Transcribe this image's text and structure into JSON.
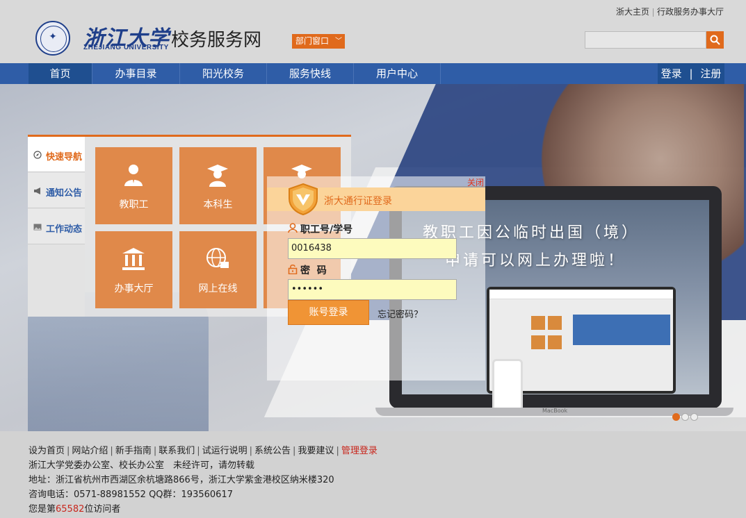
{
  "header": {
    "logo_cn": "浙江大学",
    "logo_en": "ZHEJIANG UNIVERSITY",
    "site_title": "校务服务网",
    "dept_button": "部门窗口",
    "top_links": [
      "浙大主页",
      "行政服务办事大厅"
    ],
    "search": {
      "value": "",
      "icon": "search-icon"
    }
  },
  "nav": {
    "items": [
      "首页",
      "办事目录",
      "阳光校务",
      "服务快线",
      "用户中心"
    ],
    "active": "首页",
    "login": "登录",
    "divider": "|",
    "register": "注册"
  },
  "banner": {
    "headline_1": "教职工因公临时出国（境）",
    "headline_2": "申请可以网上办理啦！",
    "laptop_brand": "MacBook",
    "slide_count": 3,
    "active_slide": 1
  },
  "quick_panel": {
    "tabs": [
      {
        "label": "快速导航",
        "icon": "compass-icon"
      },
      {
        "label": "通知公告",
        "icon": "megaphone-icon"
      },
      {
        "label": "工作动态",
        "icon": "image-icon"
      }
    ],
    "tiles": [
      {
        "label": "教职工",
        "icon": "staff-icon"
      },
      {
        "label": "本科生",
        "icon": "graduate-icon"
      },
      {
        "label": "",
        "icon": "graduate-icon"
      },
      {
        "label": "办事大厅",
        "icon": "building-icon"
      },
      {
        "label": "网上在线",
        "icon": "globe-icon"
      },
      {
        "label": "",
        "icon": "tile-icon"
      }
    ]
  },
  "login": {
    "close": "关闭",
    "title": "浙大通行证登录",
    "user_label": "职工号/学号",
    "user_value": "0016438",
    "password_label": "密  码",
    "password_value": "••••••",
    "submit": "账号登录",
    "forgot": "忘记密码？"
  },
  "footer": {
    "links": [
      "设为首页",
      "网站介绍",
      "新手指南",
      "联系我们",
      "试运行说明",
      "系统公告",
      "我要建议"
    ],
    "admin_link": "管理登录",
    "line2": "浙江大学党委办公室、校长办公室　未经许可，请勿转载",
    "line3": "地址：浙江省杭州市西湖区余杭塘路866号，浙江大学紫金港校区纳米楼320",
    "line4": "咨询电话：0571-88981552 QQ群：193560617",
    "visitor_prefix": "您是第",
    "visitor_count": "65582",
    "visitor_suffix": "位访问者"
  },
  "colors": {
    "accent": "#e06a1c",
    "nav_blue": "#2f5da7",
    "tile": "#e0894a",
    "red": "#c8261c"
  }
}
